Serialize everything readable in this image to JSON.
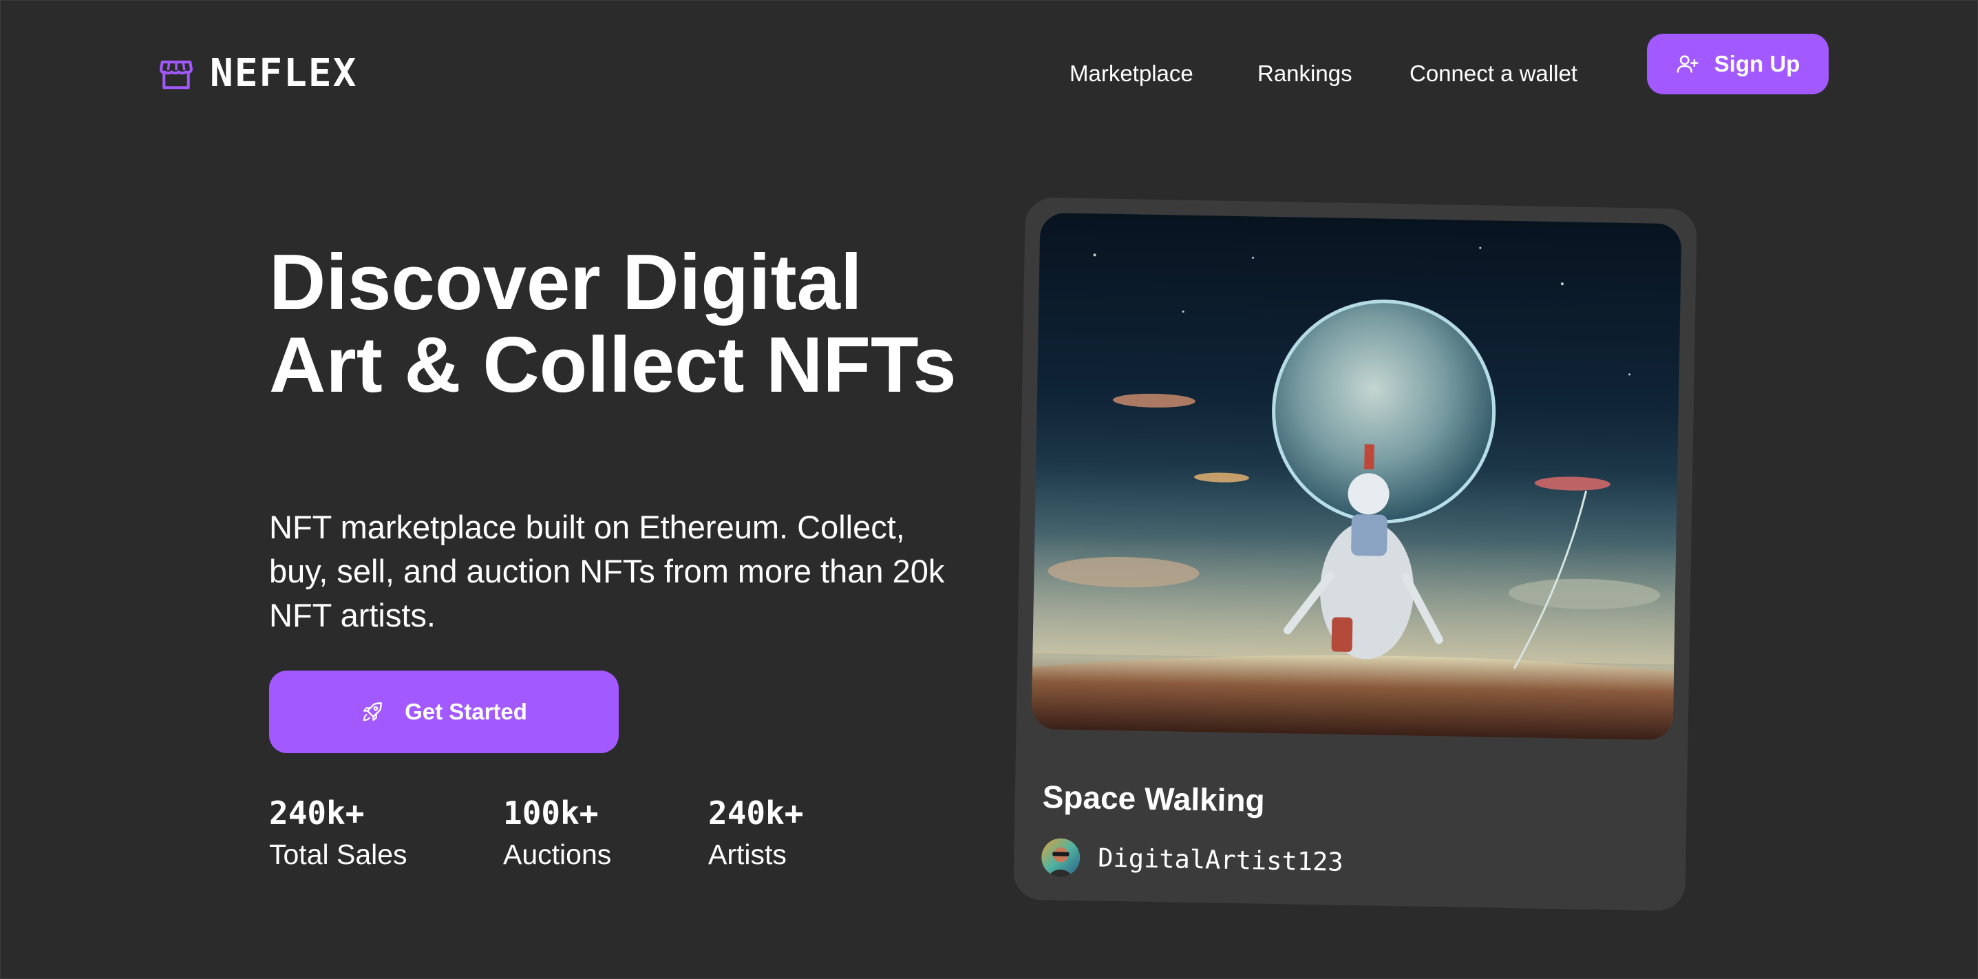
{
  "brand": {
    "name": "NEFLEX",
    "logo_icon": "storefront-icon",
    "accent_color": "#a259ff"
  },
  "nav": {
    "links": [
      {
        "label": "Marketplace"
      },
      {
        "label": "Rankings"
      },
      {
        "label": "Connect a wallet"
      }
    ],
    "signup": {
      "label": "Sign Up",
      "icon": "user-plus-icon"
    }
  },
  "hero": {
    "title": "Discover Digital Art & Collect NFTs",
    "subtitle": "NFT marketplace built on Ethereum. Collect, buy, sell, and auction NFTs from more than 20k NFT artists.",
    "cta": {
      "label": "Get Started",
      "icon": "rocket-icon"
    },
    "stats": [
      {
        "value": "240k+",
        "label": "Total Sales"
      },
      {
        "value": "100k+",
        "label": "Auctions"
      },
      {
        "value": "240k+",
        "label": "Artists"
      }
    ]
  },
  "featured": {
    "title": "Space Walking",
    "artist": "DigitalArtist123",
    "image": "astronaut-planet-artwork",
    "avatar": "artist-avatar"
  },
  "colors": {
    "background": "#2b2b2b",
    "card": "#3b3b3b",
    "text": "#ffffff"
  }
}
